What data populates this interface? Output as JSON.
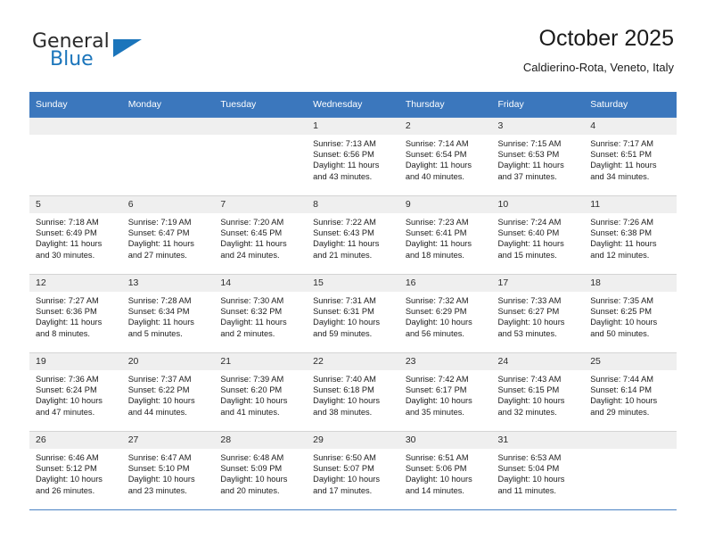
{
  "brand": {
    "name_top": "General",
    "name_bottom": "Blue",
    "logo_icon": "triangle-logo-icon",
    "accent_color": "#1b75bb"
  },
  "header": {
    "title": "October 2025",
    "subtitle": "Caldierino-Rota, Veneto, Italy",
    "header_bg_color": "#3b77bd",
    "daynum_bg_color": "#efefef"
  },
  "weekday_headers": [
    "Sunday",
    "Monday",
    "Tuesday",
    "Wednesday",
    "Thursday",
    "Friday",
    "Saturday"
  ],
  "weeks": [
    [
      {
        "day": "",
        "sunrise": "",
        "sunset": "",
        "daylight_line1": "",
        "daylight_line2": ""
      },
      {
        "day": "",
        "sunrise": "",
        "sunset": "",
        "daylight_line1": "",
        "daylight_line2": ""
      },
      {
        "day": "",
        "sunrise": "",
        "sunset": "",
        "daylight_line1": "",
        "daylight_line2": ""
      },
      {
        "day": "1",
        "sunrise": "Sunrise: 7:13 AM",
        "sunset": "Sunset: 6:56 PM",
        "daylight_line1": "Daylight: 11 hours",
        "daylight_line2": "and 43 minutes."
      },
      {
        "day": "2",
        "sunrise": "Sunrise: 7:14 AM",
        "sunset": "Sunset: 6:54 PM",
        "daylight_line1": "Daylight: 11 hours",
        "daylight_line2": "and 40 minutes."
      },
      {
        "day": "3",
        "sunrise": "Sunrise: 7:15 AM",
        "sunset": "Sunset: 6:53 PM",
        "daylight_line1": "Daylight: 11 hours",
        "daylight_line2": "and 37 minutes."
      },
      {
        "day": "4",
        "sunrise": "Sunrise: 7:17 AM",
        "sunset": "Sunset: 6:51 PM",
        "daylight_line1": "Daylight: 11 hours",
        "daylight_line2": "and 34 minutes."
      }
    ],
    [
      {
        "day": "5",
        "sunrise": "Sunrise: 7:18 AM",
        "sunset": "Sunset: 6:49 PM",
        "daylight_line1": "Daylight: 11 hours",
        "daylight_line2": "and 30 minutes."
      },
      {
        "day": "6",
        "sunrise": "Sunrise: 7:19 AM",
        "sunset": "Sunset: 6:47 PM",
        "daylight_line1": "Daylight: 11 hours",
        "daylight_line2": "and 27 minutes."
      },
      {
        "day": "7",
        "sunrise": "Sunrise: 7:20 AM",
        "sunset": "Sunset: 6:45 PM",
        "daylight_line1": "Daylight: 11 hours",
        "daylight_line2": "and 24 minutes."
      },
      {
        "day": "8",
        "sunrise": "Sunrise: 7:22 AM",
        "sunset": "Sunset: 6:43 PM",
        "daylight_line1": "Daylight: 11 hours",
        "daylight_line2": "and 21 minutes."
      },
      {
        "day": "9",
        "sunrise": "Sunrise: 7:23 AM",
        "sunset": "Sunset: 6:41 PM",
        "daylight_line1": "Daylight: 11 hours",
        "daylight_line2": "and 18 minutes."
      },
      {
        "day": "10",
        "sunrise": "Sunrise: 7:24 AM",
        "sunset": "Sunset: 6:40 PM",
        "daylight_line1": "Daylight: 11 hours",
        "daylight_line2": "and 15 minutes."
      },
      {
        "day": "11",
        "sunrise": "Sunrise: 7:26 AM",
        "sunset": "Sunset: 6:38 PM",
        "daylight_line1": "Daylight: 11 hours",
        "daylight_line2": "and 12 minutes."
      }
    ],
    [
      {
        "day": "12",
        "sunrise": "Sunrise: 7:27 AM",
        "sunset": "Sunset: 6:36 PM",
        "daylight_line1": "Daylight: 11 hours",
        "daylight_line2": "and 8 minutes."
      },
      {
        "day": "13",
        "sunrise": "Sunrise: 7:28 AM",
        "sunset": "Sunset: 6:34 PM",
        "daylight_line1": "Daylight: 11 hours",
        "daylight_line2": "and 5 minutes."
      },
      {
        "day": "14",
        "sunrise": "Sunrise: 7:30 AM",
        "sunset": "Sunset: 6:32 PM",
        "daylight_line1": "Daylight: 11 hours",
        "daylight_line2": "and 2 minutes."
      },
      {
        "day": "15",
        "sunrise": "Sunrise: 7:31 AM",
        "sunset": "Sunset: 6:31 PM",
        "daylight_line1": "Daylight: 10 hours",
        "daylight_line2": "and 59 minutes."
      },
      {
        "day": "16",
        "sunrise": "Sunrise: 7:32 AM",
        "sunset": "Sunset: 6:29 PM",
        "daylight_line1": "Daylight: 10 hours",
        "daylight_line2": "and 56 minutes."
      },
      {
        "day": "17",
        "sunrise": "Sunrise: 7:33 AM",
        "sunset": "Sunset: 6:27 PM",
        "daylight_line1": "Daylight: 10 hours",
        "daylight_line2": "and 53 minutes."
      },
      {
        "day": "18",
        "sunrise": "Sunrise: 7:35 AM",
        "sunset": "Sunset: 6:25 PM",
        "daylight_line1": "Daylight: 10 hours",
        "daylight_line2": "and 50 minutes."
      }
    ],
    [
      {
        "day": "19",
        "sunrise": "Sunrise: 7:36 AM",
        "sunset": "Sunset: 6:24 PM",
        "daylight_line1": "Daylight: 10 hours",
        "daylight_line2": "and 47 minutes."
      },
      {
        "day": "20",
        "sunrise": "Sunrise: 7:37 AM",
        "sunset": "Sunset: 6:22 PM",
        "daylight_line1": "Daylight: 10 hours",
        "daylight_line2": "and 44 minutes."
      },
      {
        "day": "21",
        "sunrise": "Sunrise: 7:39 AM",
        "sunset": "Sunset: 6:20 PM",
        "daylight_line1": "Daylight: 10 hours",
        "daylight_line2": "and 41 minutes."
      },
      {
        "day": "22",
        "sunrise": "Sunrise: 7:40 AM",
        "sunset": "Sunset: 6:18 PM",
        "daylight_line1": "Daylight: 10 hours",
        "daylight_line2": "and 38 minutes."
      },
      {
        "day": "23",
        "sunrise": "Sunrise: 7:42 AM",
        "sunset": "Sunset: 6:17 PM",
        "daylight_line1": "Daylight: 10 hours",
        "daylight_line2": "and 35 minutes."
      },
      {
        "day": "24",
        "sunrise": "Sunrise: 7:43 AM",
        "sunset": "Sunset: 6:15 PM",
        "daylight_line1": "Daylight: 10 hours",
        "daylight_line2": "and 32 minutes."
      },
      {
        "day": "25",
        "sunrise": "Sunrise: 7:44 AM",
        "sunset": "Sunset: 6:14 PM",
        "daylight_line1": "Daylight: 10 hours",
        "daylight_line2": "and 29 minutes."
      }
    ],
    [
      {
        "day": "26",
        "sunrise": "Sunrise: 6:46 AM",
        "sunset": "Sunset: 5:12 PM",
        "daylight_line1": "Daylight: 10 hours",
        "daylight_line2": "and 26 minutes."
      },
      {
        "day": "27",
        "sunrise": "Sunrise: 6:47 AM",
        "sunset": "Sunset: 5:10 PM",
        "daylight_line1": "Daylight: 10 hours",
        "daylight_line2": "and 23 minutes."
      },
      {
        "day": "28",
        "sunrise": "Sunrise: 6:48 AM",
        "sunset": "Sunset: 5:09 PM",
        "daylight_line1": "Daylight: 10 hours",
        "daylight_line2": "and 20 minutes."
      },
      {
        "day": "29",
        "sunrise": "Sunrise: 6:50 AM",
        "sunset": "Sunset: 5:07 PM",
        "daylight_line1": "Daylight: 10 hours",
        "daylight_line2": "and 17 minutes."
      },
      {
        "day": "30",
        "sunrise": "Sunrise: 6:51 AM",
        "sunset": "Sunset: 5:06 PM",
        "daylight_line1": "Daylight: 10 hours",
        "daylight_line2": "and 14 minutes."
      },
      {
        "day": "31",
        "sunrise": "Sunrise: 6:53 AM",
        "sunset": "Sunset: 5:04 PM",
        "daylight_line1": "Daylight: 10 hours",
        "daylight_line2": "and 11 minutes."
      },
      {
        "day": "",
        "sunrise": "",
        "sunset": "",
        "daylight_line1": "",
        "daylight_line2": ""
      }
    ]
  ]
}
